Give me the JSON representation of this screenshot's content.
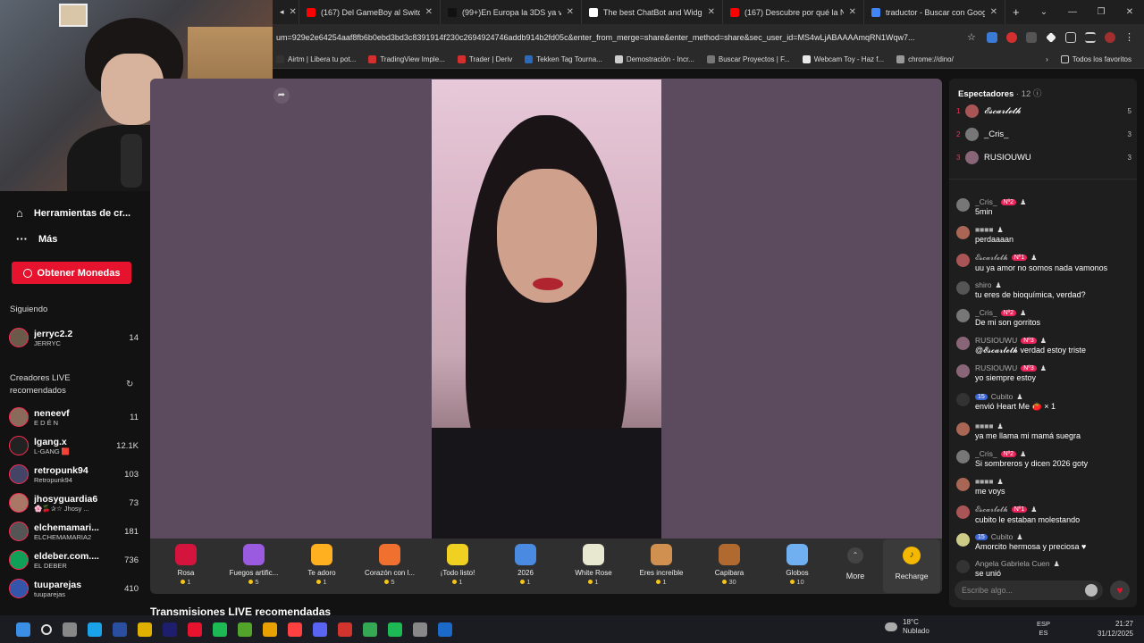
{
  "browser": {
    "tabs": [
      {
        "label": "(167) Del GameBoy al Switch: L",
        "color": "#ff0000"
      },
      {
        "label": "(99+)En Europa la 3DS ya vale",
        "color": "#111111"
      },
      {
        "label": "The best ChatBot and Widgets",
        "color": "#ffffff"
      },
      {
        "label": "(167) Descubre por qué la Nin",
        "color": "#ff0000"
      },
      {
        "label": "traductor - Buscar con Google",
        "color": "#4285f4"
      }
    ],
    "new_tab": "+",
    "url": "um=929e2e64254aaf8fb6b0ebd3bd3c8391914f230c2694924746addb914b2fd05c&enter_from_merge=share&enter_method=share&sec_user_id=MS4wLjABAAAAmqRN1Wqw7...",
    "bookmarks": [
      "Airtm | Libera tu pot...",
      "TradingView Imple...",
      "Trader | Deriv",
      "Tekken Tag Tourna...",
      "Demostración - Incr...",
      "Buscar Proyectos | F...",
      "Webcam Toy - Haz f...",
      "chrome://dino/"
    ],
    "all_bookmarks": "Todos los favoritos"
  },
  "sidebar": {
    "nav": [
      {
        "label": "Herramientas de cr...",
        "icon": "home-icon"
      },
      {
        "label": "Más",
        "icon": "more-icon"
      }
    ],
    "coins_button": "Obtener Monedas",
    "following_title": "Siguiendo",
    "following": [
      {
        "name": "jerryc2.2",
        "sub": "JERRYC",
        "count": "14",
        "color": "#6b5a4a"
      }
    ],
    "recommended_title": "Creadores LIVE recomendados",
    "recommended": [
      {
        "name": "neneevf",
        "sub": "E D É N",
        "count": "11",
        "color": "#8a6a5a"
      },
      {
        "name": "lgang.x",
        "sub": "L-GANG 🟥",
        "count": "12.1K",
        "color": "#222222"
      },
      {
        "name": "retropunk94",
        "sub": "Retropunk94",
        "count": "103",
        "color": "#444466"
      },
      {
        "name": "jhosyguardia6",
        "sub": "🌸🍒✰☆ Jhosy ...",
        "count": "73",
        "color": "#aa7766"
      },
      {
        "name": "elchemamari...",
        "sub": "ELCHEMAMARIA2",
        "count": "181",
        "color": "#555555"
      },
      {
        "name": "eldeber.com....",
        "sub": "EL DEBER",
        "count": "736",
        "color": "#11a058"
      },
      {
        "name": "tuuparejas",
        "sub": "tuuparejas",
        "count": "410",
        "color": "#3355aa"
      }
    ]
  },
  "gifts": [
    {
      "name": "Rosa",
      "price": "1",
      "color": "#d4143c"
    },
    {
      "name": "Fuegos artific...",
      "price": "5",
      "color": "#9a5be0"
    },
    {
      "name": "Te adoro",
      "price": "1",
      "color": "#ffb020"
    },
    {
      "name": "Corazón con l...",
      "price": "5",
      "color": "#f07030"
    },
    {
      "name": "¡Todo listo!",
      "price": "1",
      "color": "#f0d020"
    },
    {
      "name": "2026",
      "price": "1",
      "color": "#4a8ae0"
    },
    {
      "name": "White Rose",
      "price": "1",
      "color": "#e8e8d0"
    },
    {
      "name": "Eres increíble",
      "price": "1",
      "color": "#d09050"
    },
    {
      "name": "Capibara",
      "price": "30",
      "color": "#b06a30"
    },
    {
      "name": "Globos",
      "price": "10",
      "color": "#70b0f0"
    }
  ],
  "gift_more": "More",
  "recharge": "Recharge",
  "recommended_streams_title": "Transmisiones LIVE recomendadas",
  "chat": {
    "viewers_label": "Espectadores",
    "viewers_count": "12",
    "top_viewers": [
      {
        "rank": "1",
        "name": "𝓔𝓼𝓬𝓪𝓻𝓵𝓮𝓽𝓱",
        "score": "5",
        "color": "#aa5555"
      },
      {
        "rank": "2",
        "name": "_Cris_",
        "score": "3",
        "color": "#777777"
      },
      {
        "rank": "3",
        "name": "RUSIOUWU",
        "score": "3",
        "color": "#886677"
      }
    ],
    "messages": [
      {
        "user": "_Cris_",
        "badge": "Nº2",
        "text": "5min",
        "color": "#777777"
      },
      {
        "user": "■■■■",
        "badge": "",
        "text": "perdaaaan",
        "color": "#aa6655"
      },
      {
        "user": "𝓔𝓼𝓬𝓪𝓻𝓵𝓮𝓽𝓱",
        "badge": "Nº1",
        "text": "uu ya amor no somos nada vamonos",
        "color": "#aa5555"
      },
      {
        "user": "shiro",
        "badge": "",
        "text": "tu eres de bioquímica, verdad?",
        "color": "#555555"
      },
      {
        "user": "_Cris_",
        "badge": "Nº2",
        "text": "De mi son gorritos",
        "color": "#777777"
      },
      {
        "user": "RUSIOUWU",
        "badge": "Nº3",
        "text": "@𝓔𝓼𝓬𝓪𝓻𝓵𝓮𝓽𝓱 verdad estoy triste",
        "color": "#886677"
      },
      {
        "user": "RUSIOUWU",
        "badge": "Nº3",
        "text": "yo siempre estoy",
        "color": "#886677"
      },
      {
        "user": "Cubito",
        "badge": "15",
        "text": "envió Heart Me 🍅 × 1",
        "color": "#333333"
      },
      {
        "user": "■■■■",
        "badge": "",
        "text": "ya me llama mi mamá suegra",
        "color": "#aa6655"
      },
      {
        "user": "_Cris_",
        "badge": "Nº2",
        "text": "Si sombreros y dicen 2026 goty",
        "color": "#777777"
      },
      {
        "user": "■■■■",
        "badge": "",
        "text": "me voys",
        "color": "#aa6655"
      },
      {
        "user": "𝓔𝓼𝓬𝓪𝓻𝓵𝓮𝓽𝓱",
        "badge": "Nº1",
        "text": "cubito le estaban molestando",
        "color": "#aa5555"
      },
      {
        "user": "Cubito",
        "badge": "15",
        "text": "Amorcito hermosa y preciosa ♥",
        "color": "#cccc88"
      },
      {
        "user": "Angela Gabriela Cuen",
        "badge": "",
        "text": "se unió",
        "color": "#333333"
      }
    ],
    "input_placeholder": "Escribe algo..."
  },
  "taskbar": {
    "temperature": "18°C",
    "weather": "Nublado",
    "lang1": "ESP",
    "lang2": "ES",
    "time": "21:27",
    "date": "31/12/2025"
  }
}
